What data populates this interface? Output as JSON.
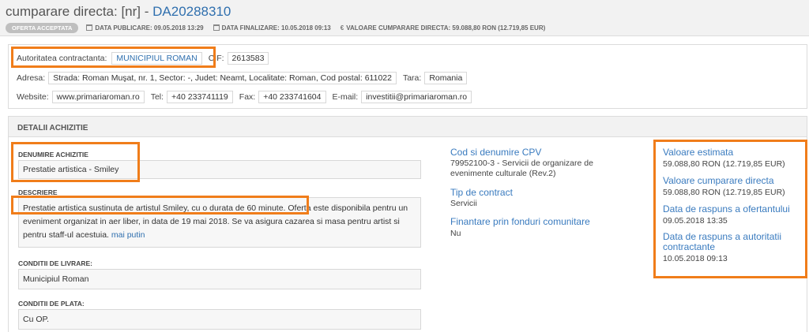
{
  "header": {
    "title_prefix": "cumparare directa: [nr] - ",
    "code": "DA20288310",
    "status_badge": "OFERTA ACCEPTATA",
    "publication_label": "DATA PUBLICARE: 09.05.2018 13:29",
    "completion_label": "DATA FINALIZARE: 10.05.2018 09:13",
    "value_label": "VALOARE CUMPARARE DIRECTA: 59.088,80  RON (12.719,85  EUR)",
    "currency_symbol": "€"
  },
  "authority": {
    "label": "Autoritatea contractanta:",
    "name": "MUNICIPIUL ROMAN",
    "cif_label": "CIF:",
    "cif": "2613583",
    "address_label": "Adresa:",
    "address": "Strada: Roman Muşat, nr. 1, Sector: -, Judet: Neamt, Localitate: Roman, Cod postal: 611022",
    "country_label": "Tara:",
    "country": "Romania",
    "website_label": "Website:",
    "website": "www.primariaroman.ro",
    "phone_label": "Tel:",
    "phone": "+40 233741119",
    "fax_label": "Fax:",
    "fax": "+40 233741604",
    "email_label": "E-mail:",
    "email": "investitii@primariaroman.ro"
  },
  "details": {
    "section_title": "DETALII ACHIZITIE",
    "name_label": "DENUMIRE ACHIZITIE",
    "name_value": "Prestatie artistica - Smiley",
    "description_label": "DESCRIERE",
    "description_text": "Prestatie artistica sustinuta de artistul Smiley, cu o durata de 60 minute. Oferta este disponibila pentru un eveniment organizat in aer liber, in data de 19 mai 2018. Se va asigura cazarea si masa pentru artist si pentru staff-ul acestuia.",
    "more_link": "mai putin",
    "delivery_label": "CONDITII DE LIVRARE:",
    "delivery_value": "Municipiul Roman",
    "payment_label": "CONDITII DE PLATA:",
    "payment_value": "Cu OP."
  },
  "cpv": {
    "cpv_label": "Cod si denumire CPV",
    "cpv_value": "79952100-3 - Servicii de organizare de evenimente culturale (Rev.2)",
    "contract_type_label": "Tip de contract",
    "contract_type_value": "Servicii",
    "eu_funding_label": "Finantare prin fonduri comunitare",
    "eu_funding_value": "Nu"
  },
  "values": {
    "estimated_label": "Valoare estimata",
    "estimated_value": "59.088,80  RON (12.719,85  EUR)",
    "purchase_label": "Valoare cumparare directa",
    "purchase_value": "59.088,80  RON (12.719,85  EUR)",
    "offer_response_label": "Data de raspuns a ofertantului",
    "offer_response_value": "09.05.2018 13:35",
    "authority_response_label": "Data de raspuns a autoritatii contractante",
    "authority_response_value": "10.05.2018 09:13"
  },
  "colors": {
    "highlight": "#f07d1a",
    "link": "#2f6fae",
    "accent_title": "#3a7bbf"
  }
}
